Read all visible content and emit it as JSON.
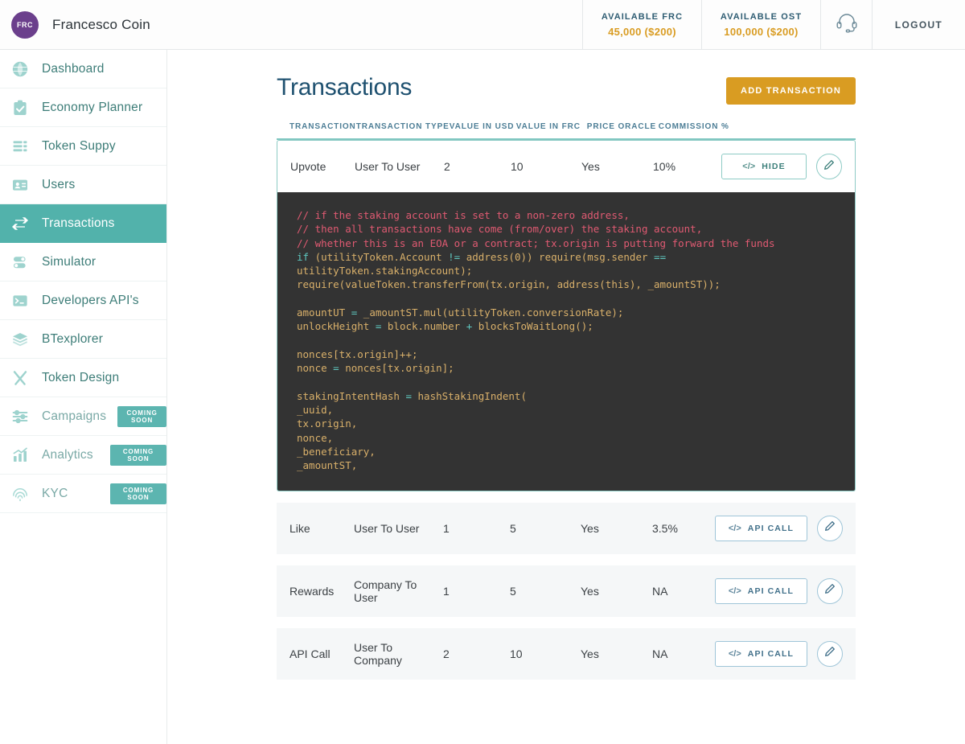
{
  "header": {
    "avatar_initials": "FRC",
    "brand_name": "Francesco Coin",
    "balances": [
      {
        "label": "AVAILABLE FRC",
        "value": "45,000 ($200)"
      },
      {
        "label": "AVAILABLE OST",
        "value": "100,000 ($200)"
      }
    ],
    "support_icon": "headset-icon",
    "logout_label": "LOGOUT"
  },
  "sidebar": {
    "items": [
      {
        "label": "Dashboard",
        "icon": "globe-icon",
        "active": false,
        "badge": null
      },
      {
        "label": "Economy Planner",
        "icon": "clipboard-check-icon",
        "active": false,
        "badge": null
      },
      {
        "label": "Token Suppy",
        "icon": "server-stack-icon",
        "active": false,
        "badge": null
      },
      {
        "label": "Users",
        "icon": "id-card-icon",
        "active": false,
        "badge": null
      },
      {
        "label": "Transactions",
        "icon": "arrows-exchange-icon",
        "active": true,
        "badge": null
      },
      {
        "label": "Simulator",
        "icon": "toggles-icon",
        "active": false,
        "badge": null
      },
      {
        "label": "Developers API's",
        "icon": "terminal-icon",
        "active": false,
        "badge": null
      },
      {
        "label": "BTexplorer",
        "icon": "layers-icon",
        "active": false,
        "badge": null
      },
      {
        "label": "Token Design",
        "icon": "compass-pen-icon",
        "active": false,
        "badge": null
      },
      {
        "label": "Campaigns",
        "icon": "sliders-icon",
        "active": false,
        "badge": "COMING SOON"
      },
      {
        "label": "Analytics",
        "icon": "bar-chart-icon",
        "active": false,
        "badge": "COMING SOON"
      },
      {
        "label": "KYC",
        "icon": "fingerprint-icon",
        "active": false,
        "badge": "COMING SOON"
      }
    ]
  },
  "main": {
    "page_title": "Transactions",
    "add_button_label": "ADD TRANSACTION",
    "columns": [
      "TRANSACTION",
      "TRANSACTION TYPE",
      "VALUE IN USD",
      "VALUE IN FRC",
      "PRICE ORACLE",
      "COMMISSION %"
    ],
    "rows": [
      {
        "transaction": "Upvote",
        "transaction_type": "User To User",
        "value_in_usd": "2",
        "value_in_frc": "10",
        "price_oracle": "Yes",
        "commission": "10%",
        "action_label": "HIDE",
        "action_icon": "code-brackets-icon",
        "edit_icon": "pencil-icon",
        "expanded": true
      },
      {
        "transaction": "Like",
        "transaction_type": "User To User",
        "value_in_usd": "1",
        "value_in_frc": "5",
        "price_oracle": "Yes",
        "commission": "3.5%",
        "action_label": "API CALL",
        "action_icon": "code-brackets-icon",
        "edit_icon": "pencil-icon",
        "expanded": false
      },
      {
        "transaction": "Rewards",
        "transaction_type": "Company To User",
        "value_in_usd": "1",
        "value_in_frc": "5",
        "price_oracle": "Yes",
        "commission": "NA",
        "action_label": "API CALL",
        "action_icon": "code-brackets-icon",
        "edit_icon": "pencil-icon",
        "expanded": false
      },
      {
        "transaction": "API Call",
        "transaction_type": "User To Company",
        "value_in_usd": "2",
        "value_in_frc": "10",
        "price_oracle": "Yes",
        "commission": "NA",
        "action_label": "API CALL",
        "action_icon": "code-brackets-icon",
        "edit_icon": "pencil-icon",
        "expanded": false
      }
    ],
    "code_snippet": {
      "lines": [
        {
          "t": "comment",
          "text": "// if the staking account is set to a non-zero address,"
        },
        {
          "t": "comment",
          "text": "// then all transactions have come (from/over) the staking account,"
        },
        {
          "t": "comment",
          "text": "// whether this is an EOA or a contract; tx.origin is putting forward the funds"
        },
        {
          "t": "code",
          "text": "if (utilityToken.Account != address(0)) require(msg.sender =="
        },
        {
          "t": "code",
          "text": "utilityToken.stakingAccount);"
        },
        {
          "t": "code",
          "text": "require(valueToken.transferFrom(tx.origin, address(this), _amountST));"
        },
        {
          "t": "blank",
          "text": ""
        },
        {
          "t": "code",
          "text": "amountUT = _amountST.mul(utilityToken.conversionRate);"
        },
        {
          "t": "code",
          "text": "unlockHeight = block.number + blocksToWaitLong();"
        },
        {
          "t": "blank",
          "text": ""
        },
        {
          "t": "code",
          "text": "nonces[tx.origin]++;"
        },
        {
          "t": "code",
          "text": "nonce = nonces[tx.origin];"
        },
        {
          "t": "blank",
          "text": ""
        },
        {
          "t": "code",
          "text": "stakingIntentHash = hashStakingIndent("
        },
        {
          "t": "code",
          "text": "_uuid,"
        },
        {
          "t": "code",
          "text": "tx.origin,"
        },
        {
          "t": "code",
          "text": "nonce,"
        },
        {
          "t": "code",
          "text": "_beneficiary,"
        },
        {
          "t": "code",
          "text": "_amountST,"
        }
      ]
    }
  },
  "colors": {
    "accent_teal": "#52b2ab",
    "accent_orange": "#d99c22",
    "title_blue": "#1f5170",
    "avatar_purple": "#6b3f8c",
    "code_bg": "#333333",
    "code_text": "#d9b06a",
    "code_comment": "#e05a72",
    "code_keyword": "#5fc9c1"
  }
}
